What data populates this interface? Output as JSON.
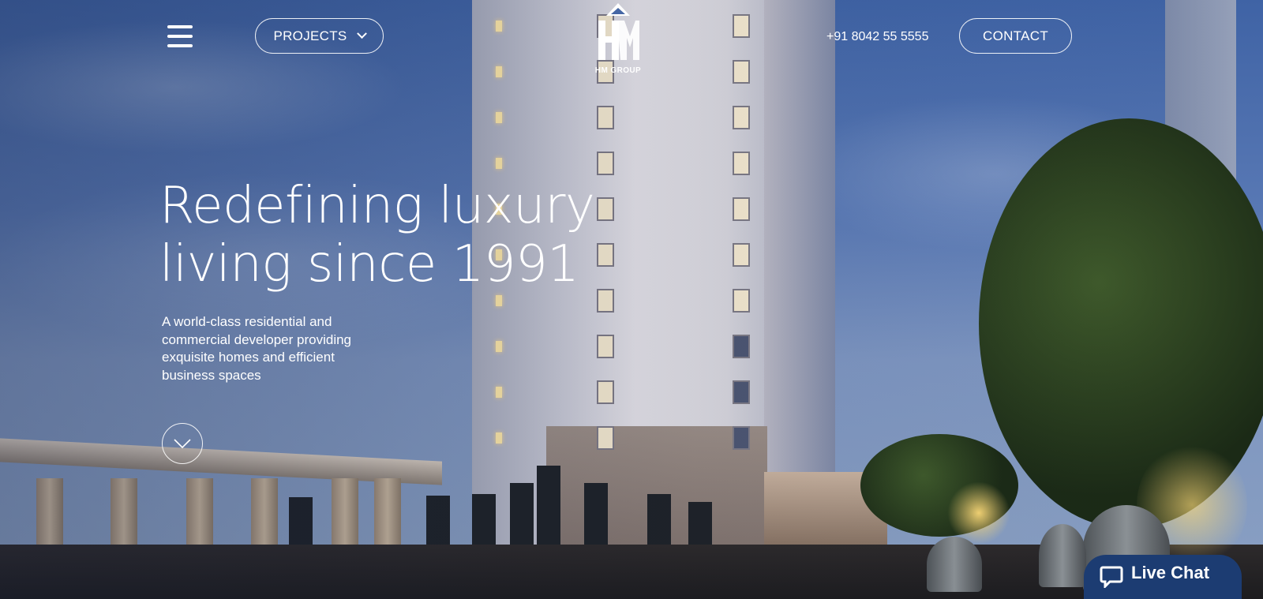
{
  "header": {
    "menu_icon": "hamburger-menu-icon",
    "projects_label": "PROJECTS",
    "projects_icon": "chevron-down-icon",
    "logo_text": "HM GROUP",
    "phone": "+91 8042 55 5555",
    "contact_label": "CONTACT"
  },
  "hero": {
    "title_line1": "Redefining luxury",
    "title_line2": "living since 1991",
    "subtitle": "A world-class residential and commercial developer providing exquisite homes and efficient business spaces",
    "scroll_icon": "chevron-down-circle-icon"
  },
  "chat": {
    "label": "Live Chat",
    "icon": "chat-bubble-icon"
  },
  "colors": {
    "text": "#ffffff",
    "chat_bg": "#1c3c72",
    "sky": "#4f6fae"
  }
}
